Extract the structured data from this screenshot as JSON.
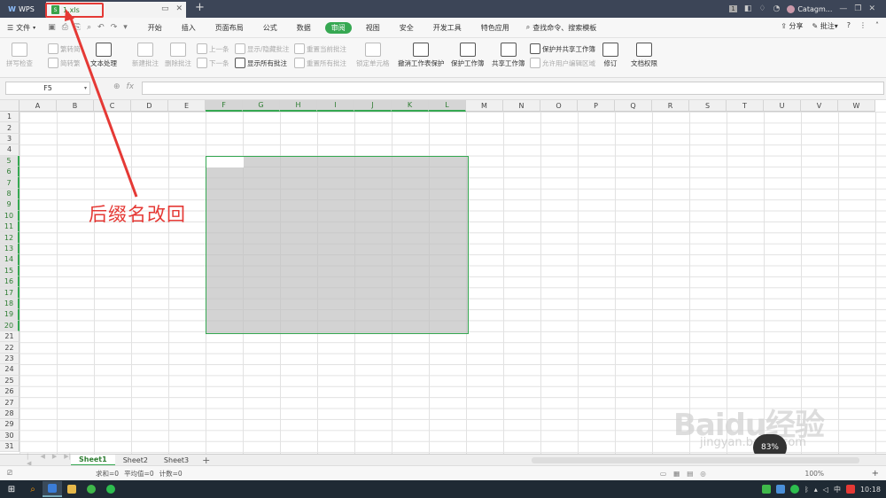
{
  "titlebar": {
    "app_name": "WPS",
    "doc_tab": "1.xls",
    "user": "Catagm...",
    "page_num": "1"
  },
  "menubar": {
    "file": "文件",
    "tabs": [
      "开始",
      "插入",
      "页面布局",
      "公式",
      "数据",
      "审阅",
      "视图",
      "安全",
      "开发工具",
      "特色应用"
    ],
    "active_tab": "审阅",
    "search_cmd": "查找命令、搜索模板",
    "share": "分享",
    "comment": "批注",
    "help": "?"
  },
  "ribbon": {
    "spell": "拼写检查",
    "trad": "繁转简",
    "simp": "简转繁",
    "text_proc": "文本处理",
    "new_comment": "新建批注",
    "del_comment": "删除批注",
    "prev": "上一条",
    "next": "下一条",
    "show_hide": "显示/隐藏批注",
    "show_all": "显示所有批注",
    "reset_cur": "重置当前批注",
    "reset_all": "重置所有批注",
    "lock_cell": "锁定单元格",
    "unprotect": "撤消工作表保护",
    "protect_book": "保护工作簿",
    "share_book": "共享工作簿",
    "protect_share": "保护并共享工作簿",
    "allow_edit": "允许用户编辑区域",
    "revise": "修订",
    "doc_perm": "文档权限"
  },
  "formula_bar": {
    "name_box": "F5",
    "fx": "fx",
    "value": ""
  },
  "grid": {
    "columns": [
      "A",
      "B",
      "C",
      "D",
      "E",
      "F",
      "G",
      "H",
      "I",
      "J",
      "K",
      "L",
      "M",
      "N",
      "O",
      "P",
      "Q",
      "R",
      "S",
      "T",
      "U",
      "V",
      "W"
    ],
    "rows": [
      "1",
      "2",
      "3",
      "4",
      "5",
      "6",
      "7",
      "8",
      "9",
      "10",
      "11",
      "12",
      "13",
      "14",
      "15",
      "16",
      "17",
      "18",
      "19",
      "20",
      "21",
      "22",
      "23",
      "24",
      "25",
      "26",
      "27",
      "28",
      "29",
      "30",
      "31"
    ],
    "selected_columns": [
      "F",
      "G",
      "H",
      "I",
      "J",
      "K",
      "L"
    ],
    "selected_rows": [
      "5",
      "6",
      "7",
      "8",
      "9",
      "10",
      "11",
      "12",
      "13",
      "14",
      "15",
      "16",
      "17",
      "18",
      "19",
      "20"
    ]
  },
  "annotation": {
    "text": "后缀名改回",
    "color": "#e53935"
  },
  "sheets": {
    "tabs": [
      "Sheet1",
      "Sheet2",
      "Sheet3"
    ],
    "active": "Sheet1",
    "add": "+"
  },
  "status": {
    "sum": "求和=0",
    "avg": "平均值=0",
    "count": "计数=0",
    "zoom": "100%",
    "plus": "+"
  },
  "watermark": {
    "text": "Baidu经验",
    "sub": "jingyan.baidu.com",
    "badge": "83%"
  },
  "taskbar": {
    "time": "10:18",
    "ime": "中"
  },
  "colors": {
    "accent": "#36a852",
    "titlebar": "#3c4557",
    "annotation": "#e53935"
  }
}
